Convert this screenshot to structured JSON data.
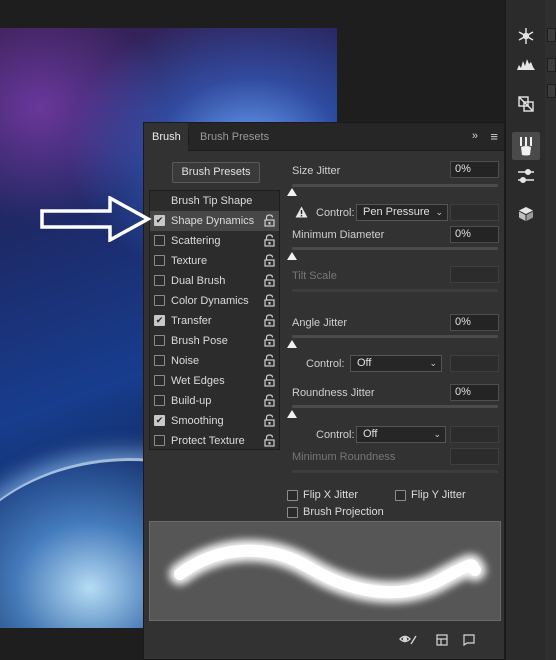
{
  "panel": {
    "tabs": [
      {
        "label": "Brush",
        "active": true
      },
      {
        "label": "Brush Presets",
        "active": false
      }
    ],
    "expand_glyph": "»",
    "menu_glyph": "≡",
    "brush_presets_button": "Brush Presets",
    "tip_shape_header": "Brush Tip Shape",
    "settings": [
      {
        "label": "Shape Dynamics",
        "checked": true,
        "selected": true
      },
      {
        "label": "Scattering",
        "checked": false
      },
      {
        "label": "Texture",
        "checked": false
      },
      {
        "label": "Dual Brush",
        "checked": false
      },
      {
        "label": "Color Dynamics",
        "checked": false
      },
      {
        "label": "Transfer",
        "checked": true
      },
      {
        "label": "Brush Pose",
        "checked": false
      },
      {
        "label": "Noise",
        "checked": false
      },
      {
        "label": "Wet Edges",
        "checked": false
      },
      {
        "label": "Build-up",
        "checked": false
      },
      {
        "label": "Smoothing",
        "checked": true
      },
      {
        "label": "Protect Texture",
        "checked": false
      }
    ],
    "dynamics": {
      "size_jitter": {
        "label": "Size Jitter",
        "value": "0%"
      },
      "size_control": {
        "label": "Control:",
        "value": "Pen Pressure"
      },
      "minimum_diameter": {
        "label": "Minimum Diameter",
        "value": "0%"
      },
      "tilt_scale": {
        "label": "Tilt Scale",
        "value": ""
      },
      "angle_jitter": {
        "label": "Angle Jitter",
        "value": "0%"
      },
      "angle_control": {
        "label": "Control:",
        "value": "Off"
      },
      "roundness_jitter": {
        "label": "Roundness Jitter",
        "value": "0%"
      },
      "roundness_control": {
        "label": "Control:",
        "value": "Off"
      },
      "minimum_roundness": {
        "label": "Minimum Roundness",
        "value": ""
      }
    },
    "bottom_options": {
      "flip_x": "Flip X Jitter",
      "flip_y": "Flip Y Jitter",
      "brush_projection": "Brush Projection"
    }
  },
  "icons": {
    "toolbar": [
      "snowflake-icon",
      "histogram-icon",
      "transform-icon",
      "brush-settings-icon",
      "adjust-sliders-icon",
      "cube-icon"
    ],
    "footer": [
      "eye-brush-icon",
      "grid-icon",
      "new-brush-icon"
    ]
  },
  "colors": {
    "panel_bg": "#323232",
    "list_bg": "#2c2c2c",
    "selected_row": "#474747",
    "annotation_arrow": "#ffffff"
  }
}
